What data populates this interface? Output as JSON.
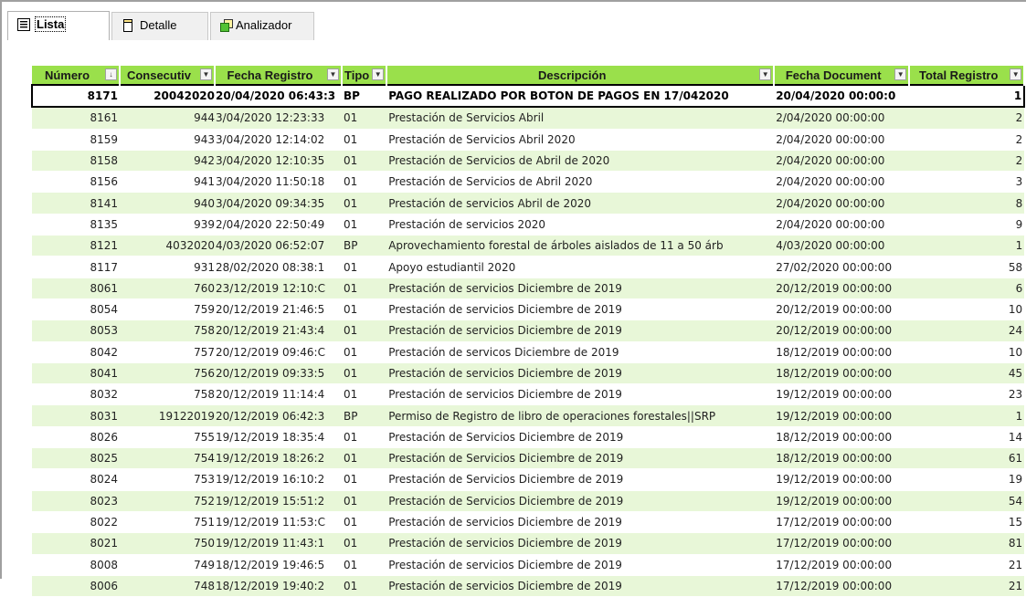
{
  "tabs": [
    {
      "label": "Lista",
      "active": true,
      "icon": "list-icon"
    },
    {
      "label": "Detalle",
      "active": false,
      "icon": "document-icon"
    },
    {
      "label": "Analizador",
      "active": false,
      "icon": "analyzer-icon"
    }
  ],
  "columns": [
    {
      "label": "Número",
      "sort": "ascending"
    },
    {
      "label": "Consecutiv"
    },
    {
      "label": "Fecha Registro"
    },
    {
      "label": "Tipo"
    },
    {
      "label": "Descripción"
    },
    {
      "label": "Fecha Document"
    },
    {
      "label": "Total Registro"
    }
  ],
  "colors": {
    "header": "#9ae04b",
    "row_alt": "#e8f7d8"
  },
  "rows": [
    {
      "numero": "8171",
      "consecutivo": "20042020",
      "fecha_registro": "20/04/2020 06:43:3",
      "tipo": "BP",
      "descripcion": "PAGO REALIZADO POR BOTON DE PAGOS  EN 17/042020",
      "fecha_documento": "20/04/2020 00:00:0",
      "total": "1",
      "selected": true
    },
    {
      "numero": "8161",
      "consecutivo": "944",
      "fecha_registro": "3/04/2020 12:23:33",
      "tipo": "01",
      "descripcion": "Prestación de Servicios Abril",
      "fecha_documento": "2/04/2020 00:00:00",
      "total": "2"
    },
    {
      "numero": "8159",
      "consecutivo": "943",
      "fecha_registro": "3/04/2020 12:14:02",
      "tipo": "01",
      "descripcion": "Prestación de Servicios Abril 2020",
      "fecha_documento": "2/04/2020 00:00:00",
      "total": "2"
    },
    {
      "numero": "8158",
      "consecutivo": "942",
      "fecha_registro": "3/04/2020 12:10:35",
      "tipo": "01",
      "descripcion": "Prestación de Servicios de Abril de 2020",
      "fecha_documento": "2/04/2020 00:00:00",
      "total": "2"
    },
    {
      "numero": "8156",
      "consecutivo": "941",
      "fecha_registro": "3/04/2020 11:50:18",
      "tipo": "01",
      "descripcion": "Prestación de Servicios de Abril 2020",
      "fecha_documento": "2/04/2020 00:00:00",
      "total": "3"
    },
    {
      "numero": "8141",
      "consecutivo": "940",
      "fecha_registro": "3/04/2020 09:34:35",
      "tipo": "01",
      "descripcion": "Prestación de servicios Abril de 2020",
      "fecha_documento": "2/04/2020 00:00:00",
      "total": "8"
    },
    {
      "numero": "8135",
      "consecutivo": "939",
      "fecha_registro": "2/04/2020 22:50:49",
      "tipo": "01",
      "descripcion": "Prestación de servicios 2020",
      "fecha_documento": "2/04/2020 00:00:00",
      "total": "9"
    },
    {
      "numero": "8121",
      "consecutivo": "4032020",
      "fecha_registro": "4/03/2020 06:52:07",
      "tipo": "BP",
      "descripcion": "Aprovechamiento forestal de árboles aislados de 11 a 50 árb",
      "fecha_documento": "4/03/2020 00:00:00",
      "total": "1"
    },
    {
      "numero": "8117",
      "consecutivo": "931",
      "fecha_registro": "28/02/2020 08:38:1",
      "tipo": "01",
      "descripcion": "Apoyo estudiantil 2020",
      "fecha_documento": "27/02/2020 00:00:00",
      "total": "58"
    },
    {
      "numero": "8061",
      "consecutivo": "760",
      "fecha_registro": "23/12/2019 12:10:C",
      "tipo": "01",
      "descripcion": "Prestación de servicios Diciembre de 2019",
      "fecha_documento": "20/12/2019 00:00:00",
      "total": "6"
    },
    {
      "numero": "8054",
      "consecutivo": "759",
      "fecha_registro": "20/12/2019 21:46:5",
      "tipo": "01",
      "descripcion": "Prestación de servicios Diciembre de 2019",
      "fecha_documento": "20/12/2019 00:00:00",
      "total": "10"
    },
    {
      "numero": "8053",
      "consecutivo": "758",
      "fecha_registro": "20/12/2019 21:43:4",
      "tipo": "01",
      "descripcion": "Prestación de servicios Diciembre de 2019",
      "fecha_documento": "20/12/2019 00:00:00",
      "total": "24"
    },
    {
      "numero": "8042",
      "consecutivo": "757",
      "fecha_registro": "20/12/2019 09:46:C",
      "tipo": "01",
      "descripcion": "Prestación de servicos Diciembre de 2019",
      "fecha_documento": "18/12/2019 00:00:00",
      "total": "10"
    },
    {
      "numero": "8041",
      "consecutivo": "756",
      "fecha_registro": "20/12/2019 09:33:5",
      "tipo": "01",
      "descripcion": "Prestación de servicios Diciembre de 2019",
      "fecha_documento": "18/12/2019 00:00:00",
      "total": "45"
    },
    {
      "numero": "8032",
      "consecutivo": "758",
      "fecha_registro": "20/12/2019 11:14:4",
      "tipo": "01",
      "descripcion": "Prestación de servicios Diciembre de 2019",
      "fecha_documento": "19/12/2019 00:00:00",
      "total": "23"
    },
    {
      "numero": "8031",
      "consecutivo": "19122019",
      "fecha_registro": "20/12/2019 06:42:3",
      "tipo": "BP",
      "descripcion": "Permiso de Registro de libro de operaciones forestales||SRP",
      "fecha_documento": "19/12/2019 00:00:00",
      "total": "1"
    },
    {
      "numero": "8026",
      "consecutivo": "755",
      "fecha_registro": "19/12/2019 18:35:4",
      "tipo": "01",
      "descripcion": "Prestación de Servicios Diciembre de 2019",
      "fecha_documento": "18/12/2019 00:00:00",
      "total": "14"
    },
    {
      "numero": "8025",
      "consecutivo": "754",
      "fecha_registro": "19/12/2019 18:26:2",
      "tipo": "01",
      "descripcion": "Prestación de Servicios Diciembre de 2019",
      "fecha_documento": "18/12/2019 00:00:00",
      "total": "61"
    },
    {
      "numero": "8024",
      "consecutivo": "753",
      "fecha_registro": "19/12/2019 16:10:2",
      "tipo": "01",
      "descripcion": "Prestación de Servicios Diciembre de 2019",
      "fecha_documento": "19/12/2019 00:00:00",
      "total": "19"
    },
    {
      "numero": "8023",
      "consecutivo": "752",
      "fecha_registro": "19/12/2019 15:51:2",
      "tipo": "01",
      "descripcion": "Prestación de Servicios Diciembre de 2019",
      "fecha_documento": "19/12/2019 00:00:00",
      "total": "54"
    },
    {
      "numero": "8022",
      "consecutivo": "751",
      "fecha_registro": "19/12/2019 11:53:C",
      "tipo": "01",
      "descripcion": "Prestación de servicios Diciembre de 2019",
      "fecha_documento": "17/12/2019 00:00:00",
      "total": "15"
    },
    {
      "numero": "8021",
      "consecutivo": "750",
      "fecha_registro": "19/12/2019 11:43:1",
      "tipo": "01",
      "descripcion": "Prestación de servicios Diciembre de 2019",
      "fecha_documento": "17/12/2019 00:00:00",
      "total": "81"
    },
    {
      "numero": "8008",
      "consecutivo": "749",
      "fecha_registro": "18/12/2019 19:46:5",
      "tipo": "01",
      "descripcion": "Prestación de servicios Diciembre de 2019",
      "fecha_documento": "17/12/2019 00:00:00",
      "total": "21"
    },
    {
      "numero": "8006",
      "consecutivo": "748",
      "fecha_registro": "18/12/2019 19:40:2",
      "tipo": "01",
      "descripcion": "Prestación de servicios Diciembre de 2019",
      "fecha_documento": "17/12/2019 00:00:00",
      "total": "21"
    }
  ]
}
